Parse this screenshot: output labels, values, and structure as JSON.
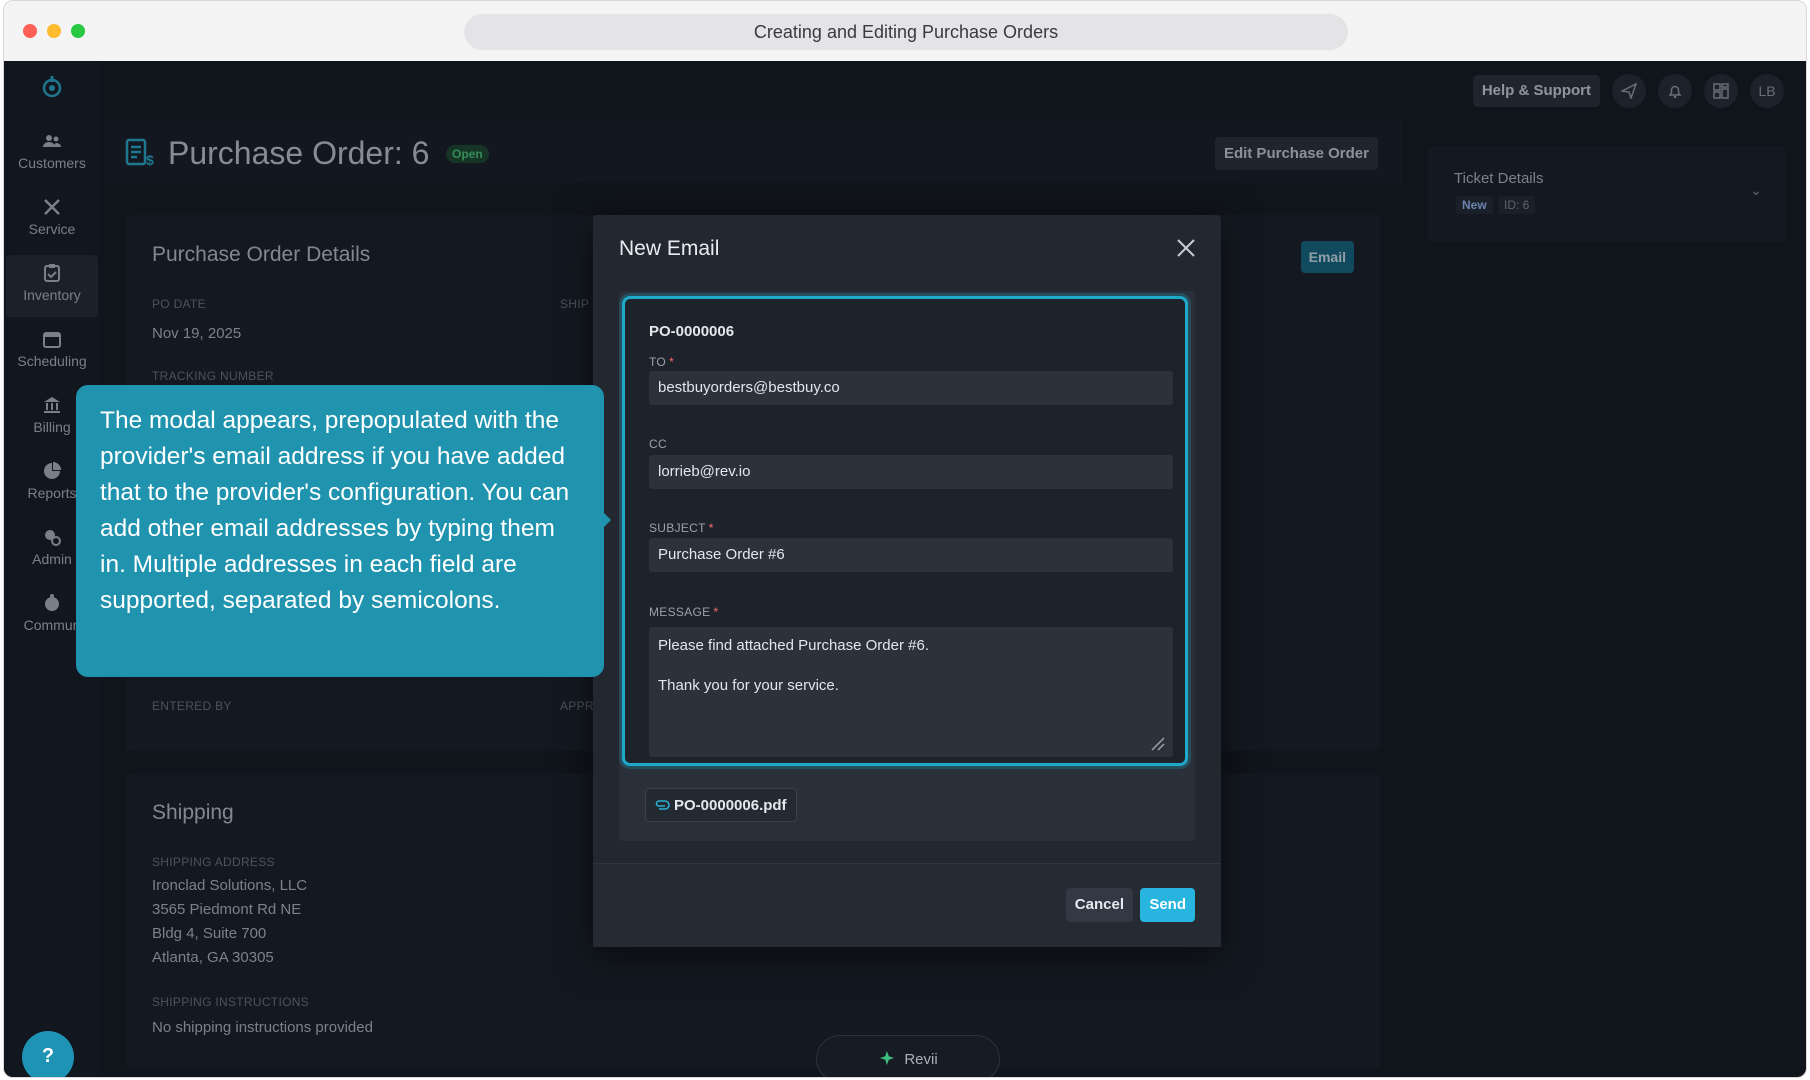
{
  "browser": {
    "title": "Creating and Editing Purchase Orders"
  },
  "sidebar": {
    "items": [
      {
        "label": "Customers",
        "icon": "users-icon"
      },
      {
        "label": "Service",
        "icon": "tools-icon"
      },
      {
        "label": "Inventory",
        "icon": "clipboard-icon",
        "active": true
      },
      {
        "label": "Scheduling",
        "icon": "calendar-icon"
      },
      {
        "label": "Billing",
        "icon": "bank-icon"
      },
      {
        "label": "Reports",
        "icon": "pie-chart-icon"
      },
      {
        "label": "Admin",
        "icon": "admin-gear-icon"
      },
      {
        "label": "Commun",
        "icon": "community-icon"
      }
    ]
  },
  "topbar": {
    "help_label": "Help & Support",
    "avatar_initials": "LB"
  },
  "header": {
    "title": "Purchase Order: 6",
    "status": "Open",
    "edit_label": "Edit Purchase Order"
  },
  "details": {
    "title": "Purchase Order Details",
    "po_date_label": "PO DATE",
    "po_date_value": "Nov 19, 2025",
    "ship_label": "SHIP",
    "tracking_label": "TRACKING NUMBER",
    "entered_by_label": "ENTERED BY",
    "approved_label": "APPR",
    "email_label": "Email"
  },
  "shipping": {
    "title": "Shipping",
    "address_label": "SHIPPING ADDRESS",
    "address_lines": [
      "Ironclad Solutions, LLC",
      "3565 Piedmont Rd NE",
      "Bldg 4, Suite 700",
      "Atlanta, GA 30305"
    ],
    "instructions_label": "SHIPPING INSTRUCTIONS",
    "instructions_value": "No shipping instructions provided"
  },
  "ticket": {
    "title": "Ticket Details",
    "status": "New",
    "id": "ID: 6"
  },
  "modal": {
    "title": "New Email",
    "po_number": "PO-0000006",
    "to_label": "TO",
    "to_value": "bestbuyorders@bestbuy.co",
    "cc_label": "CC",
    "cc_value": "lorrieb@rev.io",
    "subject_label": "SUBJECT",
    "subject_value": "Purchase Order #6",
    "message_label": "MESSAGE",
    "message_line1": "Please find attached Purchase Order #6.",
    "message_line2": "Thank you for your service.",
    "attachment": "PO-0000006.pdf",
    "cancel_label": "Cancel",
    "send_label": "Send",
    "required_mark": "*"
  },
  "tooltip": {
    "text": "The modal appears, prepopulated with the provider's email address if you have added that to the provider's configuration. You can add other email addresses by typing them in. Multiple addresses in each field are supported, separated by semicolons."
  },
  "help_fab": "?",
  "revii": "Revii",
  "colors": {
    "accent": "#1ea9c9",
    "send": "#27b5e0",
    "tooltip": "#2093ae",
    "open_badge": "#4fd17d"
  }
}
